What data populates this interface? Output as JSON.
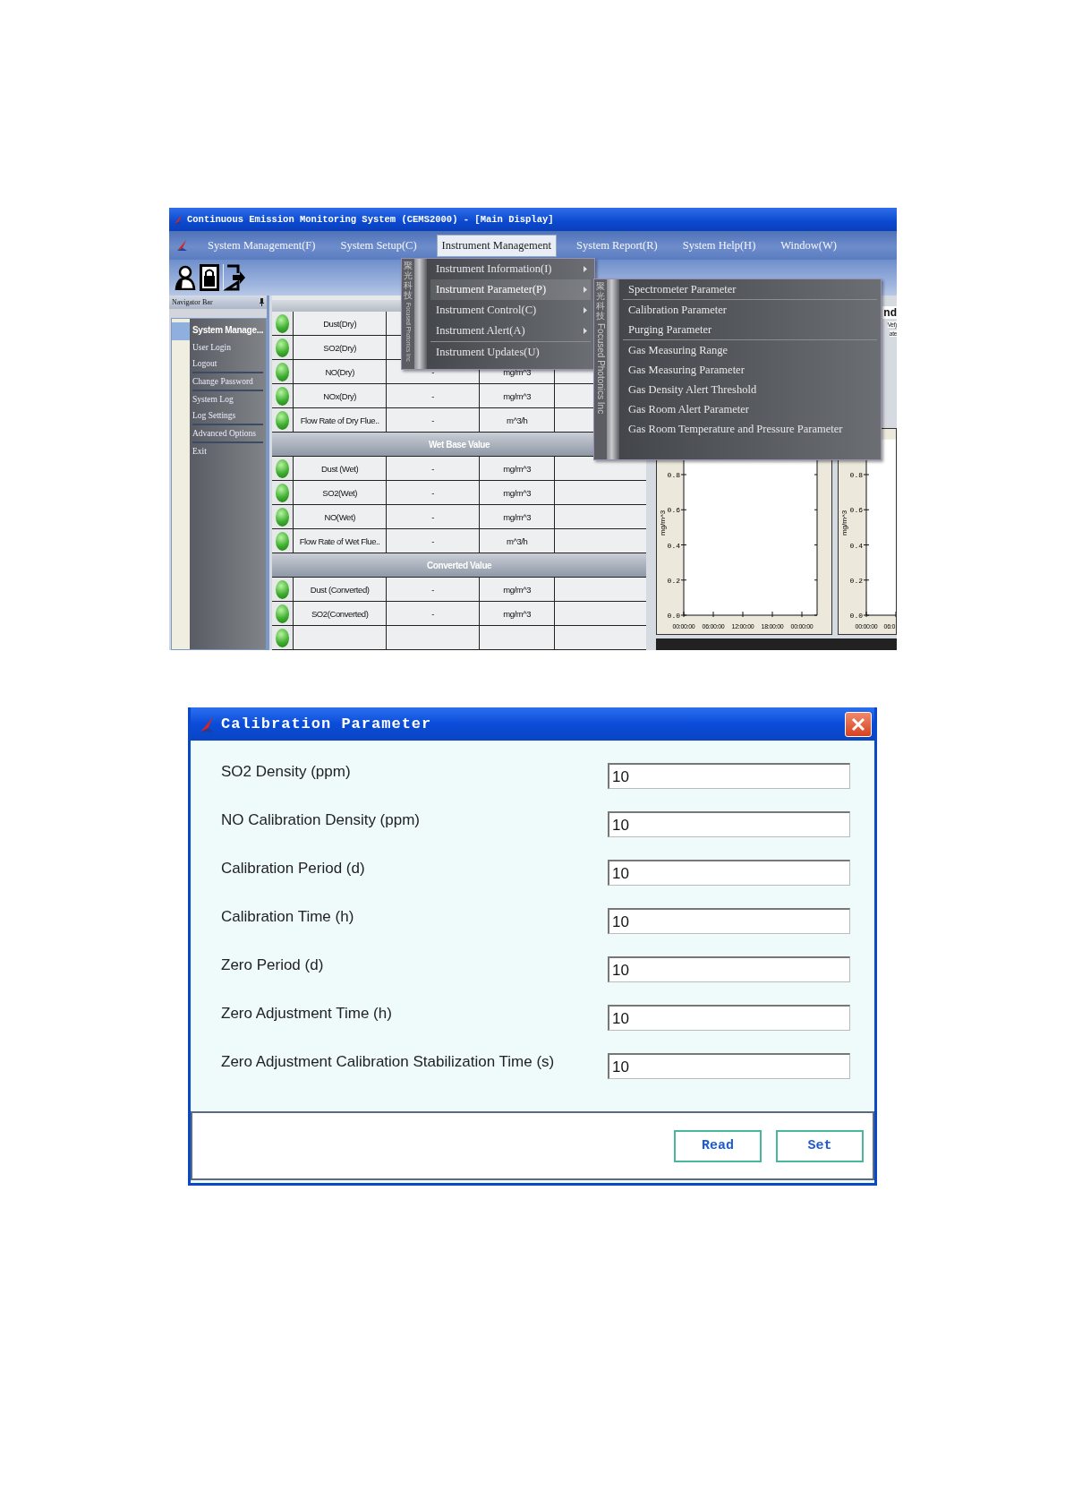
{
  "app_window": {
    "title": "Continuous Emission Monitoring System (CEMS2000) - [Main Display]",
    "menu": [
      {
        "label": "System Management(F)",
        "selected": false
      },
      {
        "label": "System Setup(C)",
        "selected": false
      },
      {
        "label": "Instrument Management",
        "selected": true
      },
      {
        "label": "System Report(R)",
        "selected": false
      },
      {
        "label": "System Help(H)",
        "selected": false
      },
      {
        "label": "Window(W)",
        "selected": false
      }
    ],
    "navigator": {
      "title": "Navigator Bar",
      "group": "System Manage...",
      "groups": [
        [
          "User Login",
          "Logout"
        ],
        [
          "Change Password"
        ],
        [
          "System Log",
          "Log Settings"
        ],
        [
          "Advanced Options"
        ],
        [
          "Exit"
        ]
      ]
    },
    "table": {
      "rows": [
        {
          "kind": "data",
          "name": "Dust(Dry)"
        },
        {
          "kind": "data",
          "name": "SO2(Dry)"
        },
        {
          "kind": "data",
          "name": "NO(Dry)",
          "value": "-",
          "unit": "mg/m^3"
        },
        {
          "kind": "data",
          "name": "NOx(Dry)",
          "value": "-",
          "unit": "mg/m^3"
        },
        {
          "kind": "data",
          "name": "Flow Rate of Dry Flue..",
          "value": "-",
          "unit": "m^3/h"
        },
        {
          "kind": "section",
          "title": "Wet Base Value"
        },
        {
          "kind": "data",
          "name": "Dust (Wet)",
          "value": "-",
          "unit": "mg/m^3"
        },
        {
          "kind": "data",
          "name": "SO2(Wet)",
          "value": "-",
          "unit": "mg/m^3"
        },
        {
          "kind": "data",
          "name": "NO(Wet)",
          "value": "-",
          "unit": "mg/m^3"
        },
        {
          "kind": "data",
          "name": "Flow Rate of Wet Flue..",
          "value": "-",
          "unit": "m^3/h"
        },
        {
          "kind": "section",
          "title": "Converted Value"
        },
        {
          "kind": "data",
          "name": "Dust (Converted)",
          "value": "-",
          "unit": "mg/m^3"
        },
        {
          "kind": "data",
          "name": "SO2(Converted)",
          "value": "-",
          "unit": "mg/m^3"
        },
        {
          "kind": "partial"
        }
      ]
    },
    "instrument_menu": {
      "strip": {
        "chinese": "聚光科技",
        "latin": "Focused Photonics Inc"
      },
      "groups": [
        [
          {
            "label": "Instrument Information(I)",
            "submenu": true,
            "selected": false
          },
          {
            "label": "Instrument Parameter(P)",
            "submenu": true,
            "selected": true
          },
          {
            "label": "Instrument Control(C)",
            "submenu": true,
            "selected": false
          },
          {
            "label": "Instrument Alert(A)",
            "submenu": true,
            "selected": false
          }
        ],
        [
          {
            "label": "Instrument Updates(U)",
            "submenu": false,
            "selected": false
          }
        ]
      ]
    },
    "parameter_submenu": {
      "strip": {
        "chinese": "聚光科技",
        "latin": "Focused Photonics Inc"
      },
      "groups": [
        [
          "Spectrometer Parameter"
        ],
        [
          "Calibration Parameter",
          "Purging Parameter"
        ],
        [
          "Gas Measuring Range",
          "Gas Measuring Parameter",
          "Gas Density Alert Threshold",
          "Gas Room Alert Parameter",
          "Gas Room Temperature and Pressure Parameter"
        ]
      ]
    },
    "right_panel": {
      "heading": "nd",
      "fragments": [
        "Vet)",
        "ate"
      ]
    },
    "charts": [
      {
        "chart_data": {
          "type": "line",
          "ylabel": "mg/m^3",
          "ylim": [
            0,
            1
          ],
          "yticks": [
            {
              "value": 0,
              "label": "0.0"
            },
            {
              "value": 0.2,
              "label": "0.2"
            },
            {
              "value": 0.4,
              "label": "0.4"
            },
            {
              "value": 0.6,
              "label": "0.6"
            },
            {
              "value": 0.8,
              "label": "0.8"
            }
          ],
          "categories": [
            "00:00:00",
            "06:00:00",
            "12:00:00",
            "18:00:00",
            "00:00:00"
          ]
        }
      },
      {
        "chart_data": {
          "type": "line",
          "ylabel": "mg/m^3",
          "ylim": [
            0,
            1
          ],
          "yticks": [
            {
              "value": 0,
              "label": "0.0"
            },
            {
              "value": 0.2,
              "label": "0.2"
            },
            {
              "value": 0.4,
              "label": "0.4"
            },
            {
              "value": 0.6,
              "label": "0.6"
            },
            {
              "value": 0.8,
              "label": "0.8"
            }
          ],
          "categories": [
            "00:00:00",
            "06:0"
          ]
        }
      }
    ]
  },
  "dialog": {
    "title": "Calibration Parameter",
    "fields": [
      {
        "label": "SO2 Density (ppm)",
        "value": "10"
      },
      {
        "label": "NO Calibration Density (ppm)",
        "value": "10"
      },
      {
        "label": "Calibration Period (d)",
        "value": "10"
      },
      {
        "label": "Calibration Time (h)",
        "value": "10"
      },
      {
        "label": "Zero Period (d)",
        "value": "10"
      },
      {
        "label": "Zero Adjustment Time (h)",
        "value": "10"
      },
      {
        "label": "Zero Adjustment Calibration Stabilization Time (s)",
        "value": "10"
      }
    ],
    "buttons": [
      "Read",
      "Set"
    ]
  }
}
